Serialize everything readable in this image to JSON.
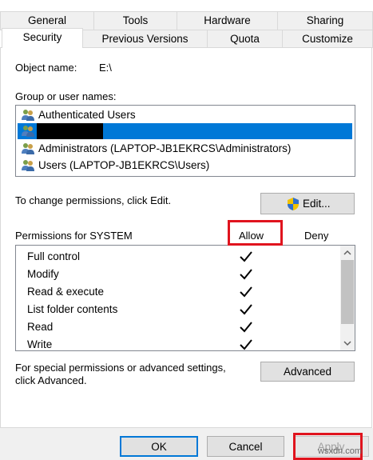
{
  "tabs": {
    "row1": [
      "General",
      "Tools",
      "Hardware",
      "Sharing"
    ],
    "row2": [
      "Security",
      "Previous Versions",
      "Quota",
      "Customize"
    ],
    "active": "Security"
  },
  "object": {
    "label": "Object name:",
    "value": "E:\\"
  },
  "groups": {
    "label": "Group or user names:",
    "items": [
      {
        "name": "Authenticated Users",
        "icon": "users-icon"
      },
      {
        "name": "",
        "icon": "users-icon",
        "selected": true,
        "redacted": true
      },
      {
        "name": "Administrators (LAPTOP-JB1EKRCS\\Administrators)",
        "icon": "users-icon"
      },
      {
        "name": "Users (LAPTOP-JB1EKRCS\\Users)",
        "icon": "users-icon"
      }
    ]
  },
  "change_text": "To change permissions, click Edit.",
  "edit_button": {
    "label": "Edit...",
    "icon": "shield-icon"
  },
  "permissions": {
    "header": "Permissions for SYSTEM",
    "allow": "Allow",
    "deny": "Deny",
    "items": [
      {
        "name": "Full control",
        "allow": true,
        "deny": false
      },
      {
        "name": "Modify",
        "allow": true,
        "deny": false
      },
      {
        "name": "Read & execute",
        "allow": true,
        "deny": false
      },
      {
        "name": "List folder contents",
        "allow": true,
        "deny": false
      },
      {
        "name": "Read",
        "allow": true,
        "deny": false
      },
      {
        "name": "Write",
        "allow": true,
        "deny": false
      }
    ]
  },
  "advanced_text": {
    "line1": "For special permissions or advanced settings,",
    "line2": "click Advanced."
  },
  "advanced_button": "Advanced",
  "footer": {
    "ok": "OK",
    "cancel": "Cancel",
    "apply": "Apply",
    "watermark": "wsxdn.com"
  },
  "colors": {
    "selection": "#0078d7",
    "highlight": "#e0141e"
  }
}
